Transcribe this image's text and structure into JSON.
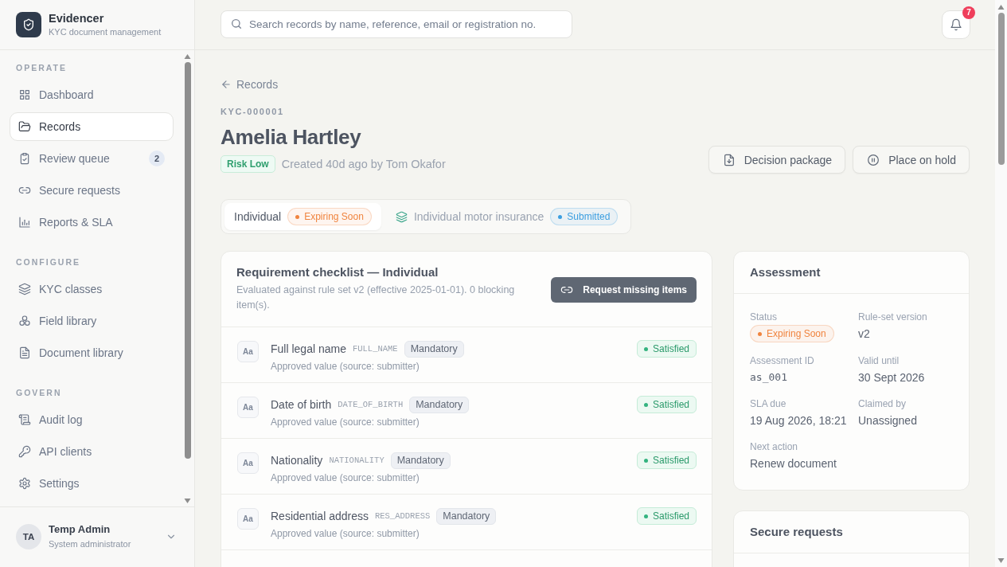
{
  "app": {
    "name": "Evidencer",
    "subtitle": "KYC document management"
  },
  "sidebar": {
    "sections": [
      {
        "title": "OPERATE",
        "items": [
          {
            "label": "Dashboard",
            "selected": false
          },
          {
            "label": "Records",
            "selected": true
          },
          {
            "label": "Review queue",
            "badge": "2",
            "selected": false
          },
          {
            "label": "Secure requests",
            "selected": false
          },
          {
            "label": "Reports & SLA",
            "selected": false
          }
        ]
      },
      {
        "title": "CONFIGURE",
        "items": [
          {
            "label": "KYC classes",
            "selected": false
          },
          {
            "label": "Field library",
            "selected": false
          },
          {
            "label": "Document library",
            "selected": false
          }
        ]
      },
      {
        "title": "GOVERN",
        "items": [
          {
            "label": "Audit log",
            "selected": false
          },
          {
            "label": "API clients",
            "selected": false
          },
          {
            "label": "Settings",
            "selected": false
          }
        ]
      }
    ]
  },
  "user": {
    "initials": "TA",
    "name": "Temp Admin",
    "role": "System administrator"
  },
  "search": {
    "placeholder": "Search records by name, reference, email or registration no."
  },
  "notifications": {
    "count": "7"
  },
  "breadcrumb": {
    "back_label": "Records"
  },
  "record": {
    "reference": "KYC-000001",
    "name": "Amelia Hartley",
    "risk": "Risk Low",
    "created": "Created 40d ago by Tom Okafor"
  },
  "actions": [
    "Decision package",
    "Place on hold"
  ],
  "tabs": [
    {
      "kind": "base",
      "label": "Individual",
      "status": "Expiring Soon",
      "color": "#f0843f",
      "selected": true
    },
    {
      "kind": "class",
      "label": "Individual motor insurance",
      "status": "Submitted",
      "color": "#3b9ee0",
      "selected": false
    }
  ],
  "checklist": {
    "title": "Requirement checklist — Individual",
    "subtitle": "Evaluated against rule set v2 (effective 2025-01-01). 0 blocking item(s).",
    "button": "Request missing items",
    "items": [
      {
        "type": "Aa",
        "name": "Full legal name",
        "code": "FULL_NAME",
        "requirement": "Mandatory",
        "note": "Approved value (source: submitter)",
        "status": "Satisfied"
      },
      {
        "type": "Aa",
        "name": "Date of birth",
        "code": "DATE_OF_BIRTH",
        "requirement": "Mandatory",
        "note": "Approved value (source: submitter)",
        "status": "Satisfied"
      },
      {
        "type": "Aa",
        "name": "Nationality",
        "code": "NATIONALITY",
        "requirement": "Mandatory",
        "note": "Approved value (source: submitter)",
        "status": "Satisfied"
      },
      {
        "type": "Aa",
        "name": "Residential address",
        "code": "RES_ADDRESS",
        "requirement": "Mandatory",
        "note": "Approved value (source: submitter)",
        "status": "Satisfied"
      }
    ]
  },
  "assessment": {
    "title": "Assessment",
    "fields": [
      {
        "kind": "badge",
        "label": "Status",
        "value": "Expiring Soon",
        "color": "#f0843f"
      },
      {
        "kind": "text",
        "label": "Rule-set version",
        "value": "v2"
      },
      {
        "kind": "mono",
        "label": "Assessment ID",
        "value": "as_001"
      },
      {
        "kind": "text",
        "label": "Valid until",
        "value": "30 Sept 2026"
      },
      {
        "kind": "text",
        "label": "SLA due",
        "value": "19 Aug 2026, 18:21"
      },
      {
        "kind": "text",
        "label": "Claimed by",
        "value": "Unassigned"
      },
      {
        "kind": "text",
        "label": "Next action",
        "value": "Renew document"
      }
    ]
  },
  "secure_requests": {
    "title": "Secure requests"
  }
}
